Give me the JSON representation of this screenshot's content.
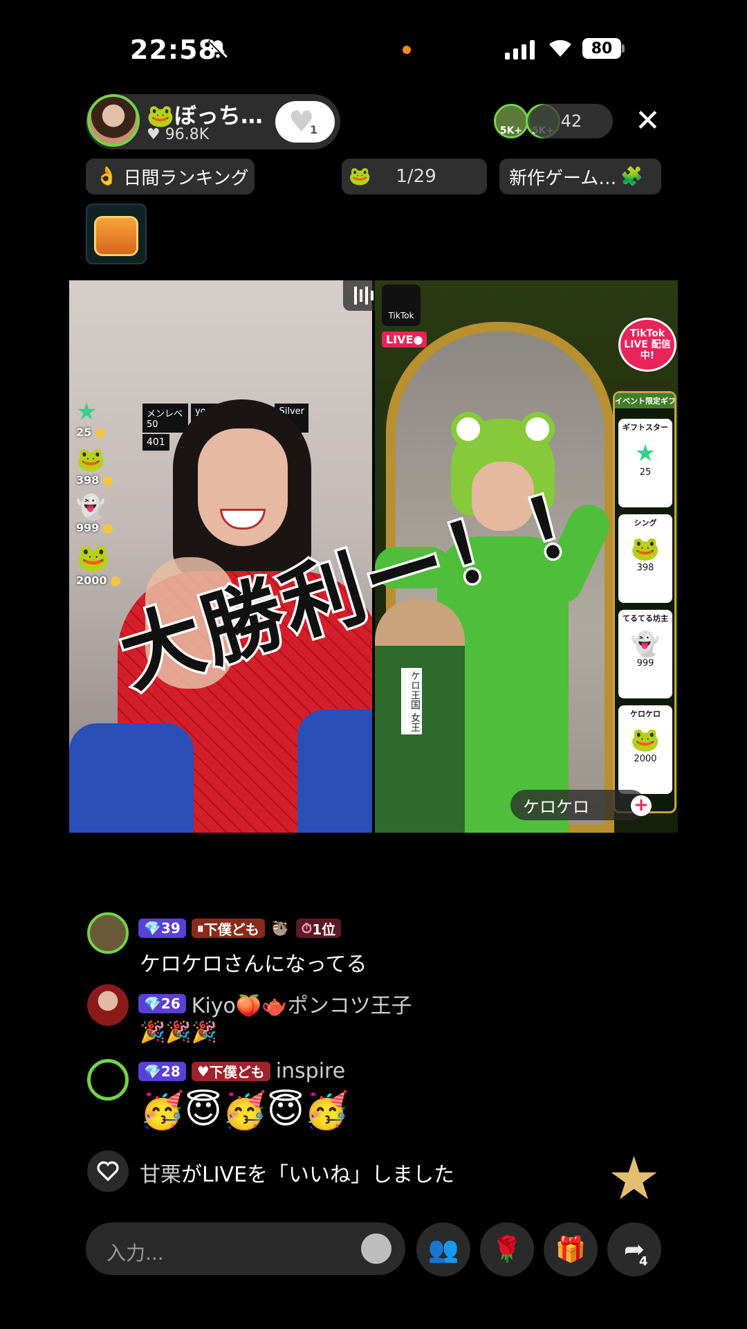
{
  "status_bar": {
    "time": "22:58",
    "battery": "80"
  },
  "host": {
    "name": "🐸ぼっち…",
    "likes": "96.8K",
    "follow_count": "1"
  },
  "viewers": {
    "top_badges": [
      "5K+",
      "5K+"
    ],
    "count": "42"
  },
  "pills": {
    "ranking": "日間ランキング",
    "match_progress": "1/29",
    "new_game": "新作ゲーム…"
  },
  "video": {
    "overlay_text": "大勝利ー！！",
    "left_gifts": [
      "25",
      "398",
      "999",
      "2000"
    ],
    "left_sign": [
      "メンレベ50",
      "yoshiki",
      "Silver",
      "401"
    ],
    "right_tiktok": "TikTok",
    "right_live": "LIVE●",
    "right_live_badge": "TikTok LIVE 配信中!",
    "right_event_header": "イベント限定ギフト",
    "right_gifts": [
      {
        "name": "ギフトスター",
        "price": "25"
      },
      {
        "name": "シング",
        "price": "398"
      },
      {
        "name": "てるてる坊主",
        "price": "999"
      },
      {
        "name": "ケロケロ",
        "price": "2000"
      }
    ],
    "right_name_tag": "ケロケロ",
    "sash_text": "ケロ王国 女王"
  },
  "chat": [
    {
      "level": "39",
      "fan_badge": "下僕ども",
      "rank_badge": "1位",
      "message": "ケロケロさんになってる"
    },
    {
      "level": "26",
      "username": "Kiyo🍑🫖ポンコツ王子",
      "message": "🎉🎉🎉"
    },
    {
      "level": "28",
      "fan_badge": "下僕ども",
      "username": "inspire",
      "message": "🥳😇🥳😇🥳"
    }
  ],
  "like_notice": {
    "user": "甘栗",
    "text": "がLIVEを「いいね」しました"
  },
  "bottom_bar": {
    "input_placeholder": "入力...",
    "share_count": "4"
  },
  "colors": {
    "accent_green": "#74d24a",
    "level_badge": "#5b3fd6",
    "background": "#000000"
  }
}
